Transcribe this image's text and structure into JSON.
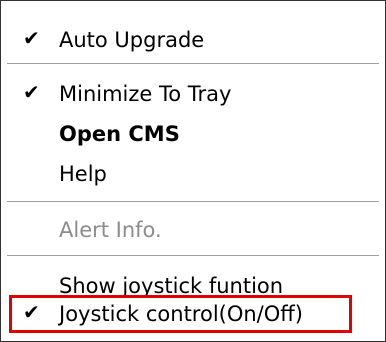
{
  "menu": {
    "items": [
      {
        "label": "Auto Upgrade",
        "checked": true,
        "bold": false,
        "disabled": false
      },
      {
        "label": "Minimize To Tray",
        "checked": true,
        "bold": false,
        "disabled": false
      },
      {
        "label": "Open CMS",
        "checked": false,
        "bold": true,
        "disabled": false
      },
      {
        "label": "Help",
        "checked": false,
        "bold": false,
        "disabled": false
      },
      {
        "label": "Alert Info.",
        "checked": false,
        "bold": false,
        "disabled": true
      },
      {
        "label": "Show joystick funtion",
        "checked": false,
        "bold": false,
        "disabled": false
      },
      {
        "label": "Joystick control(On/Off)",
        "checked": true,
        "bold": false,
        "disabled": false
      }
    ],
    "check_glyph": "✔"
  },
  "highlight": {
    "target": "Joystick control(On/Off)",
    "color": "#e00000"
  }
}
